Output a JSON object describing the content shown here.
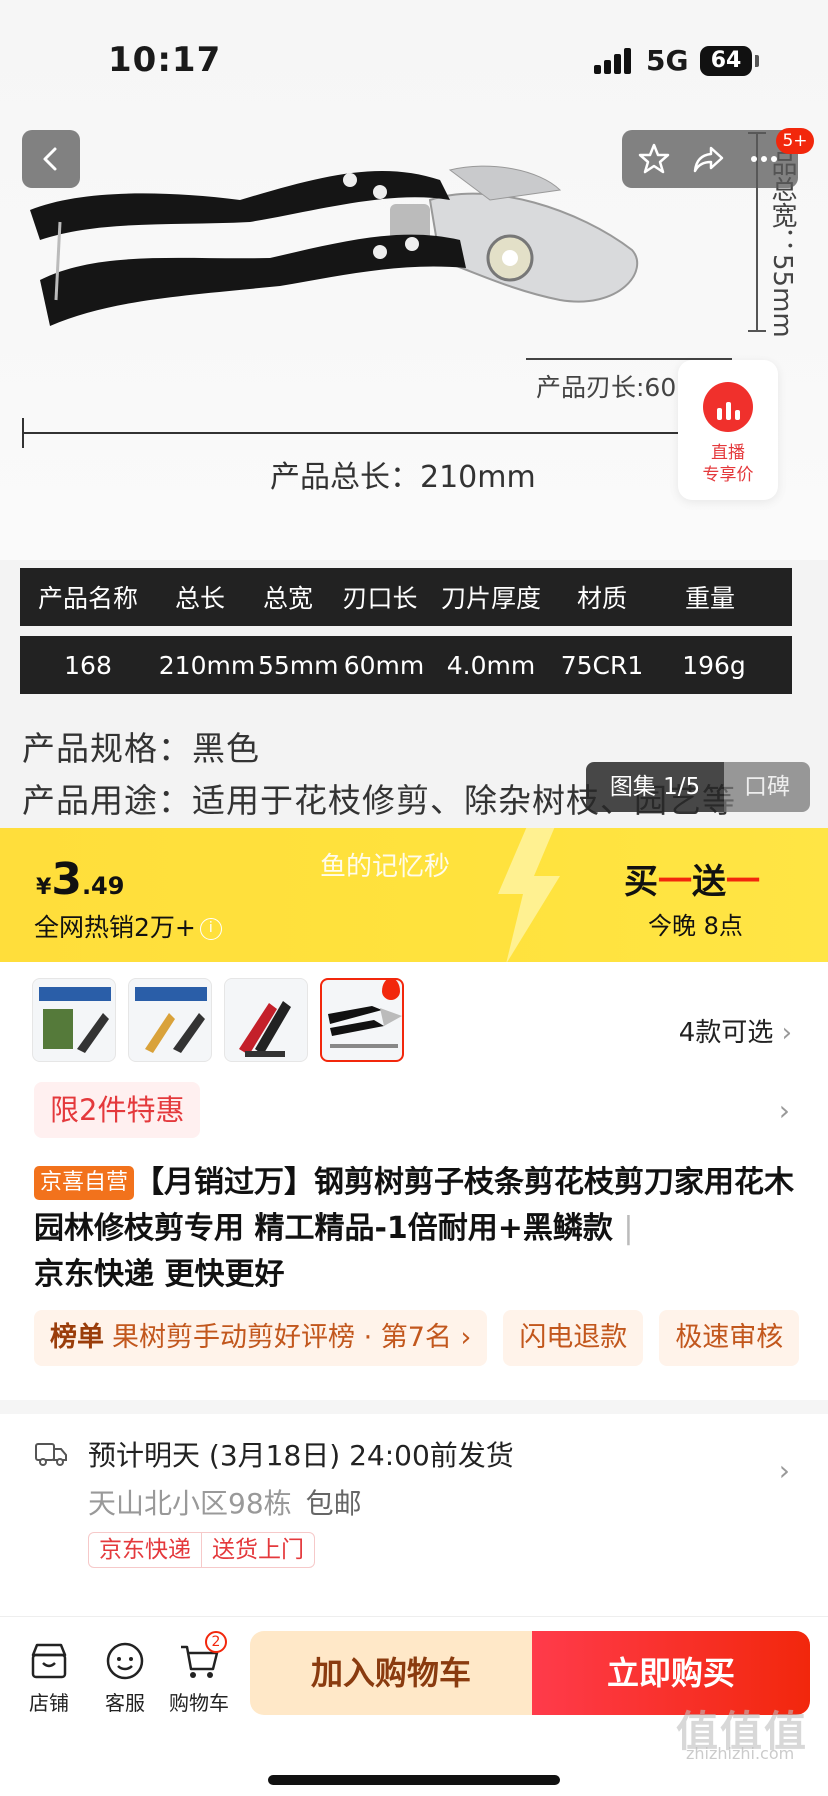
{
  "status_bar": {
    "time": "10:17",
    "network": "5G",
    "battery": "64"
  },
  "nav": {
    "notification_count": "5+"
  },
  "hero": {
    "width_label": "品总宽：55mm",
    "blade_label": "产品刃长:60mm",
    "total_label": "产品总长：210mm",
    "live_badge": {
      "line1": "直播",
      "line2": "专享价"
    },
    "spec_table": {
      "headers": [
        "产品名称",
        "总长",
        "总宽",
        "刃口长",
        "刀片厚度",
        "材质",
        "重量"
      ],
      "values": [
        "168",
        "210mm",
        "55mm",
        "60mm",
        "4.0mm",
        "75CR1",
        "196g"
      ]
    },
    "spec_line": "产品规格：黑色",
    "usage_line": "产品用途：适用于花枝修剪、除杂树枝、园艺等",
    "gallery_label": "图集 1/5",
    "reviews_label": "口碑"
  },
  "promo": {
    "currency": "¥",
    "price_int": "3",
    "price_dec": ".49",
    "sold_text": "全网热销2万+",
    "info_icon": "i",
    "watermark": "鱼的记忆秒",
    "bogo": {
      "buy": "买",
      "dash1": "一",
      "get": "送",
      "dash2": "一"
    },
    "time_text": "今晚 8点"
  },
  "variants": {
    "count_label": "4款可选",
    "chevron": "›"
  },
  "limit_tag": "限2件特惠",
  "product": {
    "brand_tag": "京喜自营",
    "title_main": "【月销过万】钢剪树剪子枝条剪花枝剪刀家用花木园林修枝剪专用 精工精品-1倍耐用+黑鳞款",
    "sep": "|",
    "title_tail": "京东快递 更快更好"
  },
  "chips": {
    "rank_bold": "榜单",
    "rank_text": "果树剪手动剪好评榜 · 第7名 ›",
    "chip2": "闪电退款",
    "chip3": "极速审核"
  },
  "shipping": {
    "line1": "预计明天 (3月18日) 24:00前发货",
    "address": "天山北小区98栋",
    "postage": "包邮",
    "tag1": "京东快递",
    "tag2": "送货上门"
  },
  "bottom_bar": {
    "store": "店铺",
    "service": "客服",
    "cart": "购物车",
    "cart_count": "2",
    "add_to_cart": "加入购物车",
    "buy_now": "立即购买"
  },
  "watermark": {
    "brand": "值值值",
    "url": "zhizhizhi.com"
  },
  "colors": {
    "accent_red": "#f2270c",
    "promo_yellow": "#ffde3b",
    "brand_orange": "#f2721c"
  }
}
